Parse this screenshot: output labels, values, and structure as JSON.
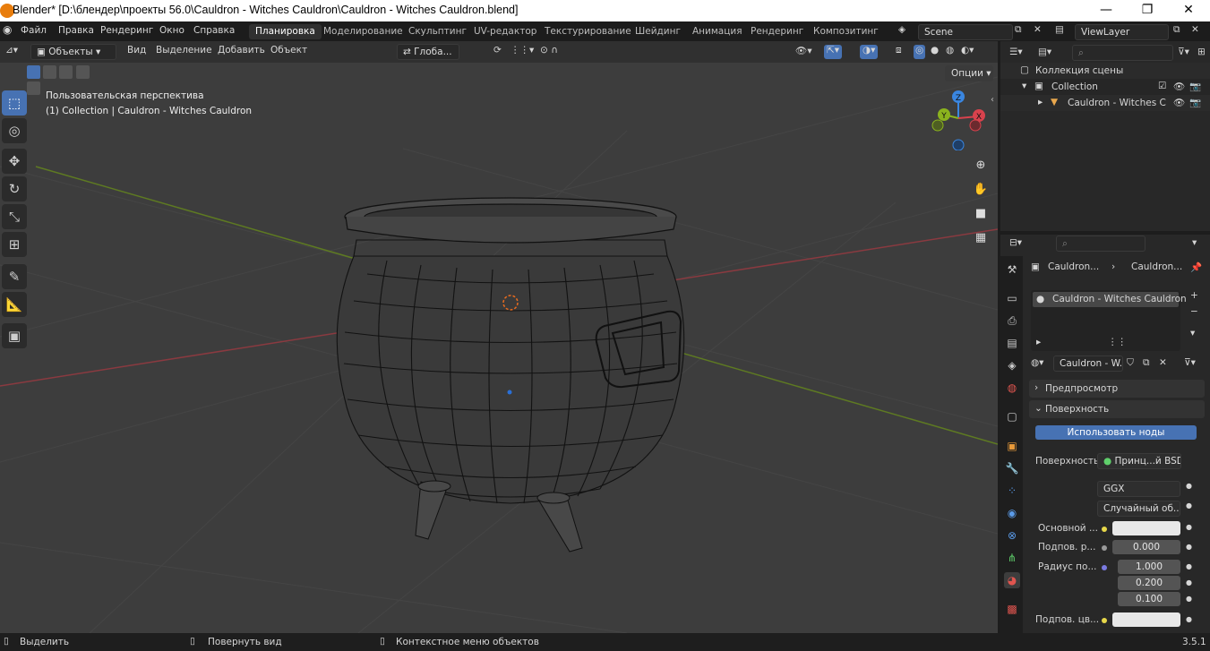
{
  "window": {
    "title": "Blender* [D:\\блендер\\проекты 56.0\\Cauldron - Witches Cauldron\\Cauldron - Witches Cauldron.blend]",
    "minimize": "—",
    "maximize": "❐",
    "close": "✕"
  },
  "menu": {
    "items": [
      "Файл",
      "Правка",
      "Рендеринг",
      "Окно",
      "Справка"
    ],
    "workspaces": [
      "Планировка",
      "Моделирование",
      "Скульптинг",
      "UV-редактор",
      "Текстурирование",
      "Шейдинг",
      "Анимация",
      "Рендеринг",
      "Композитинг"
    ],
    "active_workspace": "Планировка",
    "scene": "Scene",
    "view_layer": "ViewLayer"
  },
  "viewport_header": {
    "mode": "Объекты",
    "menus": [
      "Вид",
      "Выделение",
      "Добавить",
      "Объект"
    ],
    "transform_orientation": "Глоба...",
    "options": "Опции"
  },
  "viewport": {
    "view_name": "Пользовательская перспектива",
    "object_info": "(1) Collection | Cauldron - Witches Cauldron",
    "gizmo_axes": {
      "x": "X",
      "y": "Y",
      "z": "Z"
    }
  },
  "outliner": {
    "scene_collection": "Коллекция сцены",
    "collection": "Collection",
    "object": "Cauldron - Witches C"
  },
  "properties": {
    "breadcrumb_object": "Cauldron...",
    "breadcrumb_material": "Cauldron...",
    "material_slot": "Cauldron - Witches Cauldron",
    "material_name": "Cauldron - W...",
    "panel_preview": "Предпросмотр",
    "panel_surface": "Поверхность",
    "use_nodes_button": "Использовать ноды",
    "surface_label": "Поверхность",
    "surface_shader": "Принц...й BSDF",
    "distribution": "GGX",
    "subsurface_method": "Случайный об...",
    "base_color_label": "Основной ...",
    "subsurface_label": "Подпов. р...",
    "subsurface_value": "0.000",
    "radius_label": "Радиус по...",
    "radius_values": [
      "1.000",
      "0.200",
      "0.100"
    ],
    "subsurface_color_label": "Подпов. цв...",
    "base_color": "#e8e8e8"
  },
  "statusbar": {
    "select": "Выделить",
    "rotate_view": "Повернуть вид",
    "context_menu": "Контекстное меню объектов",
    "version": "3.5.1"
  },
  "colors": {
    "accent": "#4772b3",
    "x_axis": "#d9424d",
    "y_axis": "#8bb31e",
    "z_axis": "#3a86e0",
    "blender_orange": "#e87d0d"
  }
}
